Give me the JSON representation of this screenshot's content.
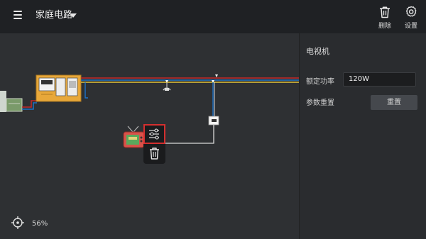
{
  "header": {
    "title": "家庭电路",
    "delete_label": "删除",
    "settings_label": "设置"
  },
  "panel": {
    "title": "电视机",
    "rated_power_label": "额定功率",
    "rated_power_value": "120W",
    "param_reset_label": "参数重置",
    "reset_button_label": "重置"
  },
  "zoom": {
    "value": "56%"
  },
  "colors": {
    "accent_red": "#d32f2f",
    "board_yellow": "#e8a83a"
  }
}
